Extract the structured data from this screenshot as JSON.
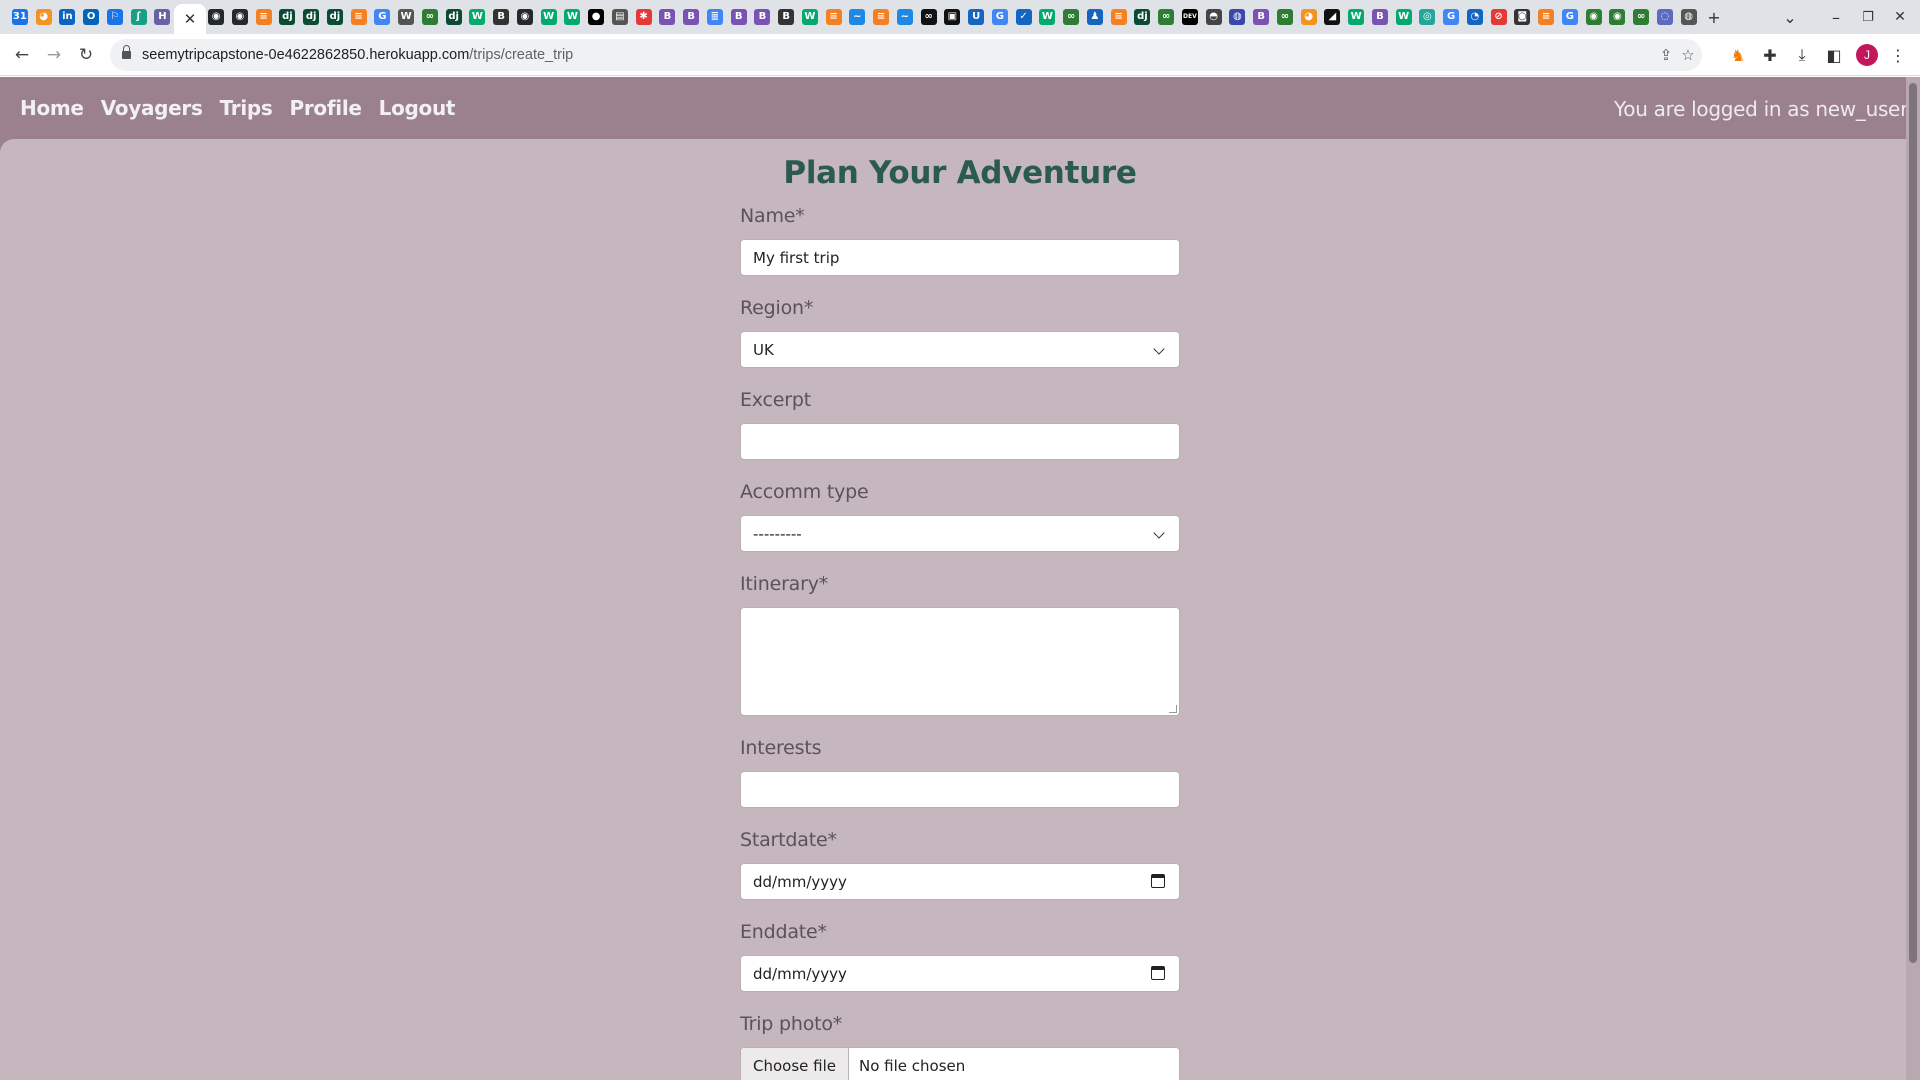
{
  "browser": {
    "tab_favicons": [
      {
        "icon": "calendar-icon",
        "color": "#1a73e8",
        "glyph": "31"
      },
      {
        "icon": "orange-swirl-icon",
        "color": "#f29423",
        "glyph": "◕"
      },
      {
        "icon": "linkedin-icon",
        "color": "#0a66c2",
        "glyph": "in"
      },
      {
        "icon": "outlook-icon",
        "color": "#0364b8",
        "glyph": "O"
      },
      {
        "icon": "flag-icon",
        "color": "#1a73e8",
        "glyph": "⚐"
      },
      {
        "icon": "leaf-icon",
        "color": "#16a085",
        "glyph": "ʃ"
      },
      {
        "icon": "heroku-icon",
        "color": "#6762a6",
        "glyph": "H"
      },
      {
        "icon": "github-icon",
        "color": "#24292e",
        "glyph": "◉"
      },
      {
        "icon": "github-icon",
        "color": "#24292e",
        "glyph": "◉"
      },
      {
        "icon": "stack-icon",
        "color": "#f48024",
        "glyph": "≡"
      },
      {
        "icon": "django-icon",
        "color": "#0c4b33",
        "glyph": "dj"
      },
      {
        "icon": "django-icon",
        "color": "#0c4b33",
        "glyph": "dj"
      },
      {
        "icon": "django-icon",
        "color": "#0c4b33",
        "glyph": "dj"
      },
      {
        "icon": "stack-icon",
        "color": "#f48024",
        "glyph": "≡"
      },
      {
        "icon": "google-icon",
        "color": "#4285f4",
        "glyph": "G"
      },
      {
        "icon": "wikipedia-icon",
        "color": "#555555",
        "glyph": "W"
      },
      {
        "icon": "infinity-icon",
        "color": "#2e7d32",
        "glyph": "∞"
      },
      {
        "icon": "django-icon",
        "color": "#0c4b33",
        "glyph": "dj"
      },
      {
        "icon": "w3schools-icon",
        "color": "#04aa6d",
        "glyph": "W"
      },
      {
        "icon": "bootstrap-icon",
        "color": "#333333",
        "glyph": "B"
      },
      {
        "icon": "github-icon",
        "color": "#24292e",
        "glyph": "◉"
      },
      {
        "icon": "w3schools-icon",
        "color": "#04aa6d",
        "glyph": "W"
      },
      {
        "icon": "w3schools-icon",
        "color": "#04aa6d",
        "glyph": "W"
      },
      {
        "icon": "medium-icon",
        "color": "#000000",
        "glyph": "●"
      },
      {
        "icon": "book-icon",
        "color": "#555555",
        "glyph": "▤"
      },
      {
        "icon": "asterisk-icon",
        "color": "#e53935",
        "glyph": "✱"
      },
      {
        "icon": "bootstrap-icon",
        "color": "#7952b3",
        "glyph": "B"
      },
      {
        "icon": "bootstrap-icon",
        "color": "#7952b3",
        "glyph": "B"
      },
      {
        "icon": "docs-icon",
        "color": "#4285f4",
        "glyph": "≣"
      },
      {
        "icon": "bootstrap-icon",
        "color": "#7952b3",
        "glyph": "B"
      },
      {
        "icon": "bootstrap-icon",
        "color": "#7952b3",
        "glyph": "B"
      },
      {
        "icon": "bootstrap-icon",
        "color": "#333333",
        "glyph": "B"
      },
      {
        "icon": "w3schools-icon",
        "color": "#04aa6d",
        "glyph": "W"
      },
      {
        "icon": "stack-icon",
        "color": "#f48024",
        "glyph": "≡"
      },
      {
        "icon": "wave-icon",
        "color": "#1e88e5",
        "glyph": "~"
      },
      {
        "icon": "stack-icon",
        "color": "#f48024",
        "glyph": "≡"
      },
      {
        "icon": "wave-icon",
        "color": "#1e88e5",
        "glyph": "~"
      },
      {
        "icon": "infinity-icon",
        "color": "#111111",
        "glyph": "∞"
      },
      {
        "icon": "briefcase-icon",
        "color": "#111111",
        "glyph": "▣"
      },
      {
        "icon": "shield-icon",
        "color": "#1565c0",
        "glyph": "U"
      },
      {
        "icon": "google-icon",
        "color": "#4285f4",
        "glyph": "G"
      },
      {
        "icon": "check-icon",
        "color": "#1565c0",
        "glyph": "✓"
      },
      {
        "icon": "w3schools-icon",
        "color": "#04aa6d",
        "glyph": "W"
      },
      {
        "icon": "infinity-icon",
        "color": "#2e7d32",
        "glyph": "∞"
      },
      {
        "icon": "people-icon",
        "color": "#1565c0",
        "glyph": "♟"
      },
      {
        "icon": "stack-icon",
        "color": "#f48024",
        "glyph": "≡"
      },
      {
        "icon": "django-icon",
        "color": "#0c4b33",
        "glyph": "dj"
      },
      {
        "icon": "infinity-icon",
        "color": "#2e7d32",
        "glyph": "∞"
      },
      {
        "icon": "dev-icon",
        "color": "#000000",
        "glyph": "DEV"
      },
      {
        "icon": "cat-icon",
        "color": "#444444",
        "glyph": "◓"
      },
      {
        "icon": "firefox-icon",
        "color": "#3949ab",
        "glyph": "◍"
      },
      {
        "icon": "bootstrap-icon",
        "color": "#7952b3",
        "glyph": "B"
      },
      {
        "icon": "infinity-icon",
        "color": "#2e7d32",
        "glyph": "∞"
      },
      {
        "icon": "orange-swirl-icon",
        "color": "#f29423",
        "glyph": "◕"
      },
      {
        "icon": "chart-icon",
        "color": "#111111",
        "glyph": "◢"
      },
      {
        "icon": "w3schools-icon",
        "color": "#04aa6d",
        "glyph": "W"
      },
      {
        "icon": "bootstrap-icon",
        "color": "#7952b3",
        "glyph": "B"
      },
      {
        "icon": "w3schools-icon",
        "color": "#04aa6d",
        "glyph": "W"
      },
      {
        "icon": "globe-icon",
        "color": "#26a69a",
        "glyph": "◎"
      },
      {
        "icon": "google-icon",
        "color": "#4285f4",
        "glyph": "G"
      },
      {
        "icon": "drop-icon",
        "color": "#1565c0",
        "glyph": "◔"
      },
      {
        "icon": "stop-icon",
        "color": "#e53935",
        "glyph": "⊘"
      },
      {
        "icon": "panda-icon",
        "color": "#333333",
        "glyph": "◙"
      },
      {
        "icon": "stack-icon",
        "color": "#f48024",
        "glyph": "≡"
      },
      {
        "icon": "google-icon",
        "color": "#4285f4",
        "glyph": "G"
      },
      {
        "icon": "github-icon",
        "color": "#2e7d32",
        "glyph": "◉"
      },
      {
        "icon": "github-icon",
        "color": "#2e7d32",
        "glyph": "◉"
      },
      {
        "icon": "infinity-icon",
        "color": "#2e7d32",
        "glyph": "∞"
      },
      {
        "icon": "circle-icon",
        "color": "#5c6bc0",
        "glyph": "◌"
      },
      {
        "icon": "chrome-icon",
        "color": "#555555",
        "glyph": "◍"
      }
    ],
    "active_tab_close": "✕",
    "new_tab": "+",
    "tab_search": "⌄",
    "minimize": "–",
    "restore": "❐",
    "close": "✕",
    "url_host": "seemytripcapstone-0e4622862850.herokuapp.com",
    "url_path": "/trips/create_trip",
    "profile_initial": "J"
  },
  "nav": {
    "home": "Home",
    "voyagers": "Voyagers",
    "trips": "Trips",
    "profile": "Profile",
    "logout": "Logout",
    "logged_in_text": "You are logged in as new_user"
  },
  "form": {
    "title": "Plan Your Adventure",
    "name_label": "Name*",
    "name_value": "My first trip",
    "region_label": "Region*",
    "region_value": "UK",
    "excerpt_label": "Excerpt",
    "excerpt_value": "",
    "accomm_label": "Accomm type",
    "accomm_value": "---------",
    "itinerary_label": "Itinerary*",
    "itinerary_value": "",
    "interests_label": "Interests",
    "interests_value": "",
    "startdate_label": "Startdate*",
    "startdate_placeholder": "dd/mm/yyyy",
    "enddate_label": "Enddate*",
    "enddate_placeholder": "dd/mm/yyyy",
    "photo_label": "Trip photo*",
    "choose_file": "Choose file",
    "no_file": "No file chosen"
  },
  "colors": {
    "navbar_bg": "#9a818d",
    "content_bg": "#c5b7bd",
    "title_color": "#2a5a50"
  }
}
